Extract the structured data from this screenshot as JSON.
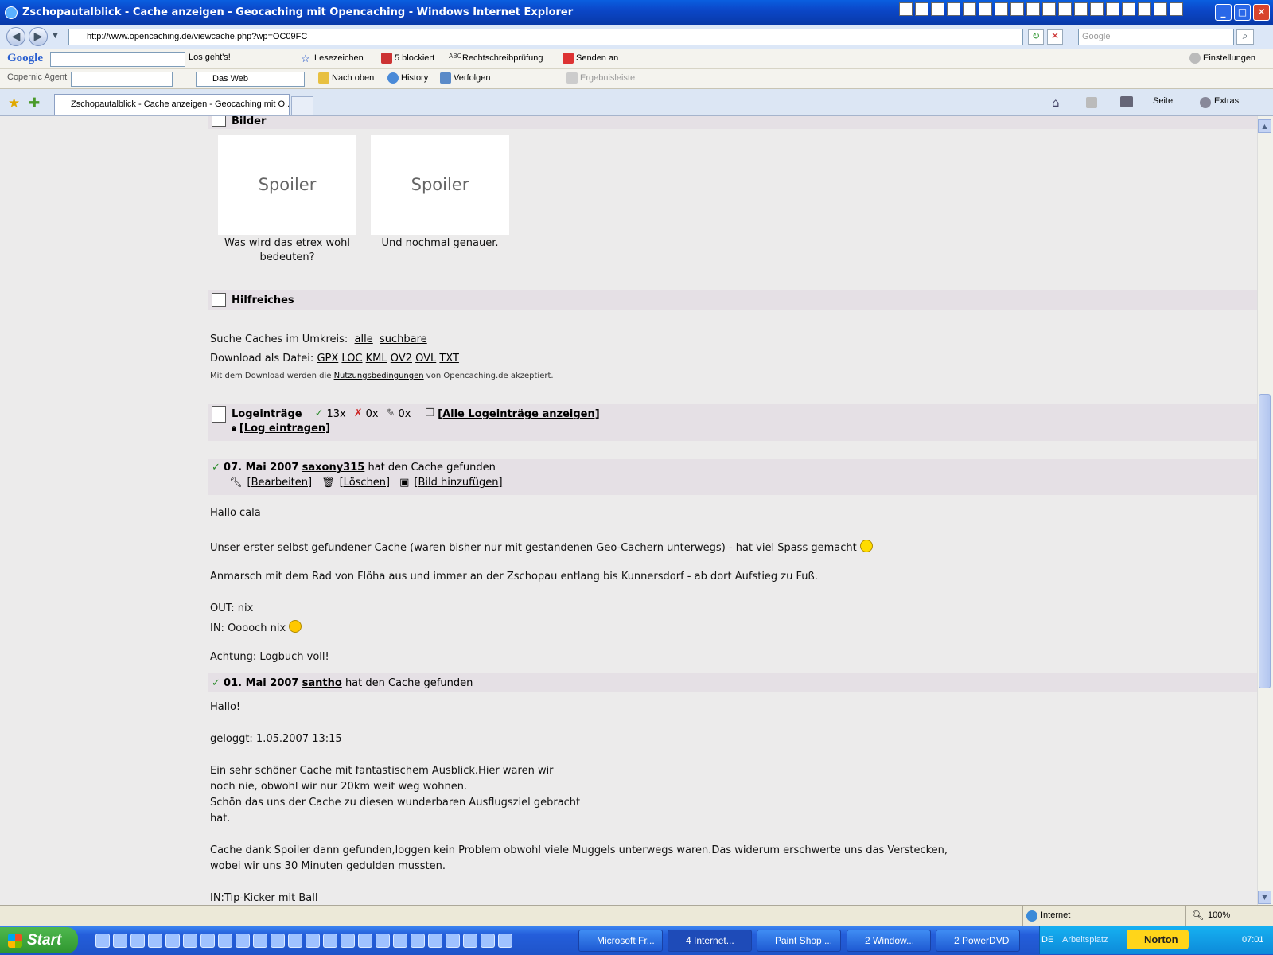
{
  "window": {
    "title": "Zschopautalblick - Cache anzeigen - Geocaching mit Opencaching - Windows Internet Explorer"
  },
  "address": {
    "url": "http://www.opencaching.de/viewcache.php?wp=OC09FC",
    "search_placeholder": "Google"
  },
  "toolbar1": {
    "google_logo": "Google",
    "go_label": "Los geht's!",
    "bookmarks": "Lesezeichen",
    "blocked": "5 blockiert",
    "spellcheck": "Rechtschreibprüfung",
    "send": "Senden an",
    "settings": "Einstellungen"
  },
  "toolbar2": {
    "copernic": "Copernic Agent",
    "web_select": "Das Web",
    "nach_oben": "Nach oben",
    "history": "History",
    "verfolgen": "Verfolgen",
    "ergebnis": "Ergebnisleiste"
  },
  "tabs": [
    {
      "label": "Zschopautalblick - Cache anzeigen - Geocaching mit O..."
    }
  ],
  "cmdbar": {
    "seite": "Seite",
    "extras": "Extras"
  },
  "bilder": {
    "header": "Bilder",
    "images": [
      {
        "label": "Spoiler",
        "caption1": "Was wird das etrex wohl",
        "caption2": "bedeuten?"
      },
      {
        "label": "Spoiler",
        "caption1": "Und nochmal genauer.",
        "caption2": ""
      }
    ]
  },
  "hilfreiches": {
    "header": "Hilfreiches",
    "search_label": "Suche Caches im Umkreis:",
    "search_links": [
      "alle",
      "suchbare"
    ],
    "download_label": "Download als Datei:",
    "download_links": [
      "GPX",
      "LOC",
      "KML",
      "OV2",
      "OVL",
      "TXT"
    ],
    "terms_prefix": "Mit dem Download werden die",
    "terms_link": "Nutzungsbedingungen",
    "terms_suffix": "von Opencaching.de akzeptiert."
  },
  "logs_header": {
    "title": "Logeinträge",
    "found": "13x",
    "notfound": "0x",
    "notes": "0x",
    "all_link": "[Alle Logeinträge anzeigen]",
    "log_link": "[Log eintragen]"
  },
  "logs": [
    {
      "date": "07. Mai 2007",
      "user": "saxony315",
      "action": "hat den Cache gefunden",
      "edit": "[Bearbeiten]",
      "delete": "[Löschen]",
      "addpic": "[Bild hinzufügen]",
      "lines": [
        "Hallo cala",
        "Unser erster selbst gefundener Cache (waren bisher nur mit gestandenen Geo-Cachern unterwegs) - hat viel Spass gemacht",
        "Anmarsch mit dem Rad von Flöha aus und immer an der Zschopau entlang bis Kunnersdorf - ab dort Aufstieg zu Fuß.",
        "OUT: nix",
        "IN: Ooooch nix",
        "Achtung: Logbuch voll!"
      ]
    },
    {
      "date": "01. Mai 2007",
      "user": "santho",
      "action": "hat den Cache gefunden",
      "lines": [
        "Hallo!",
        "geloggt: 1.05.2007 13:15",
        "Ein sehr schöner Cache mit fantastischem Ausblick.Hier waren wir",
        "noch nie, obwohl wir nur 20km weit weg wohnen.",
        "Schön das uns der Cache zu diesen wunderbaren Ausflugsziel gebracht",
        "hat.",
        "Cache dank Spoiler dann gefunden,loggen kein Problem obwohl viele Muggels unterwegs waren.Das widerum erschwerte uns das Verstecken,",
        "wobei wir uns 30 Minuten gedulden mussten.",
        "IN:Tip-Kicker mit Ball"
      ]
    }
  ],
  "status": {
    "zone": "Internet",
    "zoom": "100%"
  },
  "taskbar": {
    "start": "Start",
    "tasks": [
      "Microsoft Fr...",
      "4 Internet...",
      "Paint Shop ...",
      "2 Window...",
      "2 PowerDVD"
    ],
    "lang": "DE",
    "workspace": "Arbeitsplatz",
    "norton": "Norton",
    "clock": "07:01"
  }
}
